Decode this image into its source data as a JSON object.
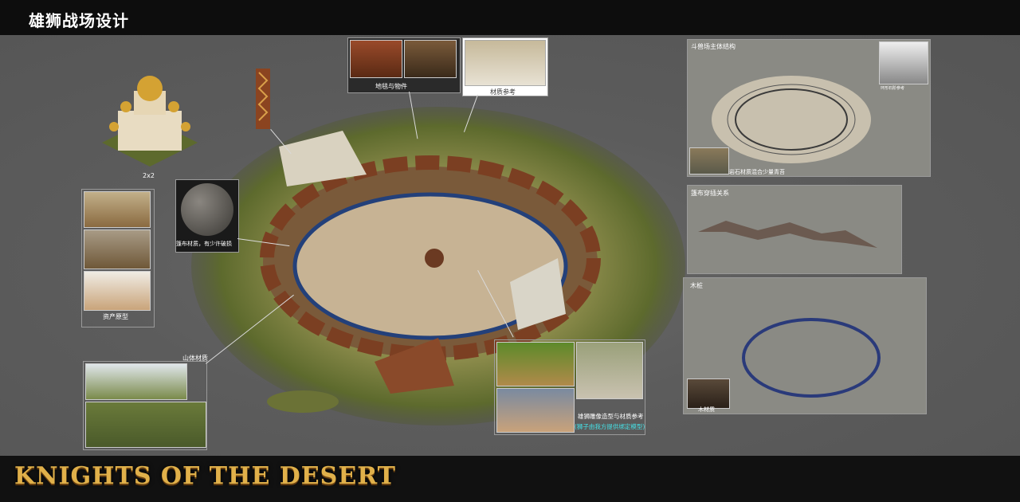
{
  "header": {
    "title": "雄狮战场设计"
  },
  "footer": {
    "logo_text": "KNIGHTS OF THE DESERT"
  },
  "castle": {
    "size_label": "2x2"
  },
  "asset_prototype": {
    "label": "资产原型"
  },
  "cloth_material": {
    "label": "篷布材质，有少许破损"
  },
  "carpet": {
    "label": "地毯与物件"
  },
  "material_ref": {
    "label": "材质参考"
  },
  "mountain": {
    "label": "山体材质"
  },
  "lion_ref": {
    "label": "雄狮雕像造型与材质参考",
    "note": "(狮子由我方提供绑定模型)"
  },
  "colosseum": {
    "label": "斗兽场主体结构",
    "rock_label": "岩石材质混合少量青苔",
    "ref_label": "环形石阶参考"
  },
  "tent_cloth": {
    "label": "篷布穿插关系"
  },
  "wood_stake": {
    "label": "木桩",
    "wood_material_label": "木材质"
  },
  "colors": {
    "topbar": "#0d0d0d",
    "canvas": "#5c5c5c",
    "accent_gold": "#e0b04a",
    "highlight_cyan": "#45e0e6"
  }
}
